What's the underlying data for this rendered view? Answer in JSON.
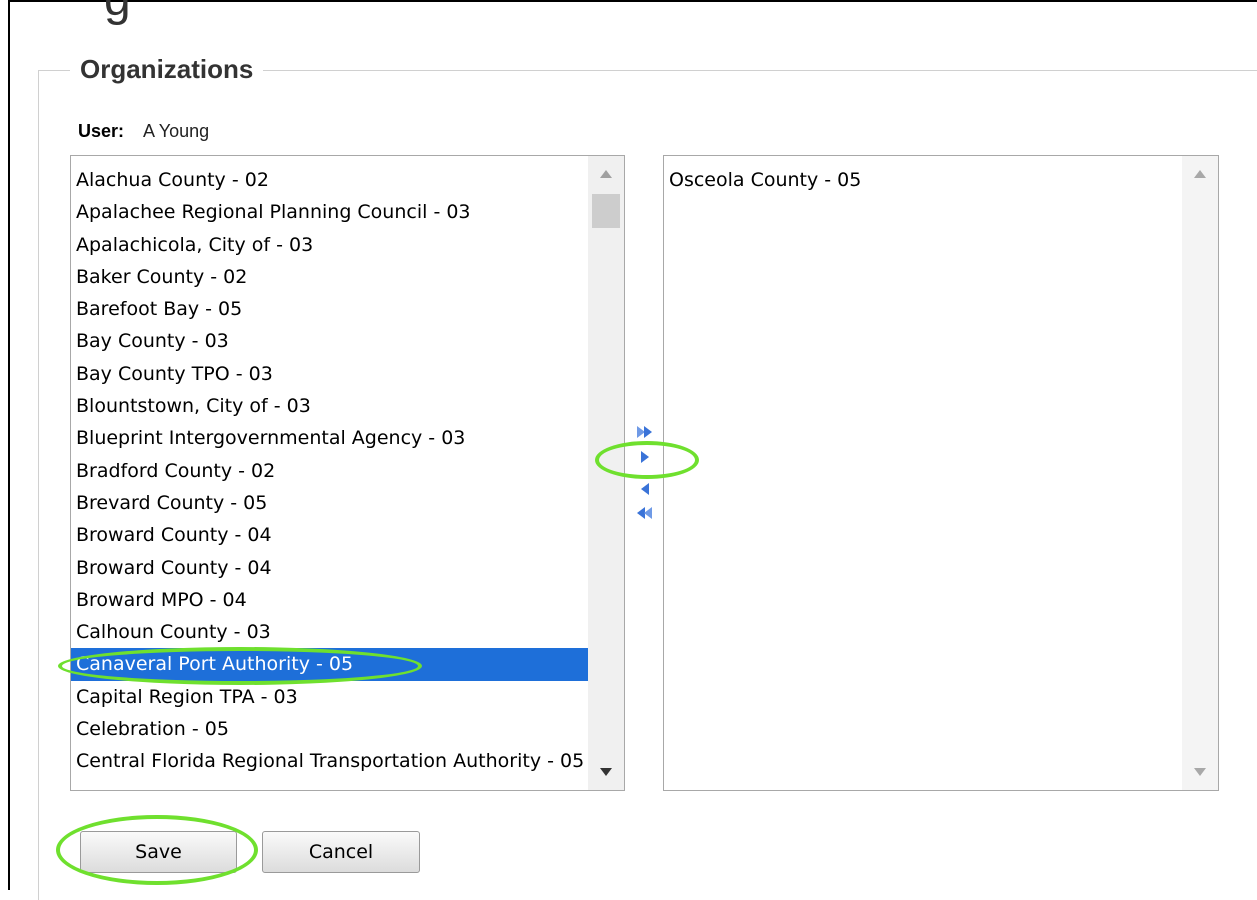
{
  "page": {
    "heading_fragment": "g",
    "section_title": "Organizations"
  },
  "user": {
    "label": "User:",
    "value": "A Young"
  },
  "available_list": {
    "items": [
      "Alachua County - 02",
      "Apalachee Regional Planning Council - 03",
      "Apalachicola, City of - 03",
      "Baker County - 02",
      "Barefoot Bay - 05",
      "Bay County - 03",
      "Bay County TPO - 03",
      "Blountstown, City of - 03",
      "Blueprint Intergovernmental Agency - 03",
      "Bradford County - 02",
      "Brevard County - 05",
      "Broward County - 04",
      "Broward County - 04",
      "Broward MPO - 04",
      "Calhoun County - 03",
      "Canaveral Port Authority - 05",
      "Capital Region TPA - 03",
      "Celebration - 05",
      "Central Florida Regional Transportation Authority - 05"
    ],
    "selected": "Canaveral Port Authority - 05"
  },
  "assigned_list": {
    "items": [
      "Osceola County - 05"
    ]
  },
  "transfer_buttons": [
    {
      "name": "move-all-right",
      "icon": "double-arrow-right-icon"
    },
    {
      "name": "move-selected-right",
      "icon": "arrow-right-icon"
    },
    {
      "name": "move-selected-left",
      "icon": "arrow-left-icon"
    },
    {
      "name": "move-all-left",
      "icon": "double-arrow-left-icon"
    }
  ],
  "buttons": {
    "save": "Save",
    "cancel": "Cancel"
  },
  "colors": {
    "selection": "#1e6fd9",
    "transfer_arrow": "#3a73d8",
    "annotation_highlight": "#6fe02e"
  }
}
